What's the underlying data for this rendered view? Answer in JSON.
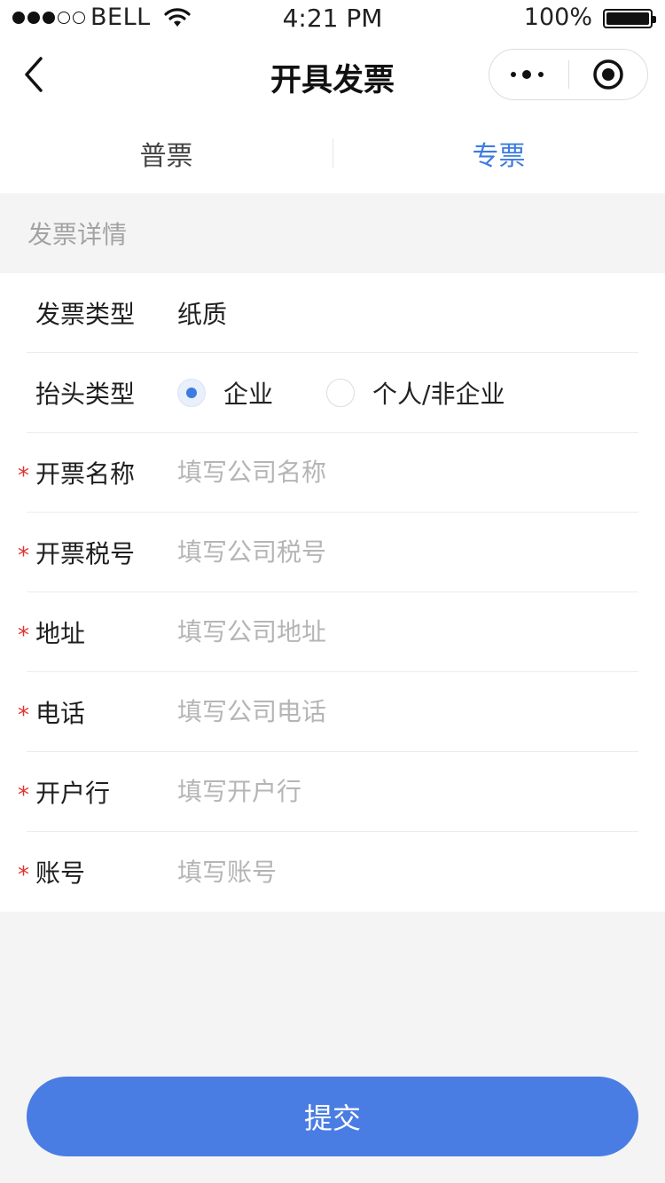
{
  "status_bar": {
    "carrier": "BELL",
    "time": "4:21 PM",
    "battery": "100%"
  },
  "nav": {
    "title": "开具发票"
  },
  "tabs": [
    {
      "label": "普票",
      "active": false
    },
    {
      "label": "专票",
      "active": true
    }
  ],
  "section": {
    "title": "发票详情"
  },
  "form": {
    "invoice_type": {
      "label": "发票类型",
      "value": "纸质"
    },
    "title_type": {
      "label": "抬头类型",
      "options": [
        {
          "label": "企业",
          "checked": true
        },
        {
          "label": "个人/非企业",
          "checked": false
        }
      ]
    },
    "fields": [
      {
        "label": "开票名称",
        "placeholder": "填写公司名称",
        "required": true
      },
      {
        "label": "开票税号",
        "placeholder": "填写公司税号",
        "required": true
      },
      {
        "label": "地址",
        "placeholder": "填写公司地址",
        "required": true
      },
      {
        "label": "电话",
        "placeholder": "填写公司电话",
        "required": true
      },
      {
        "label": "开户行",
        "placeholder": "填写开户行",
        "required": true
      },
      {
        "label": "账号",
        "placeholder": "填写账号",
        "required": true
      }
    ],
    "required_mark": "*"
  },
  "submit": {
    "label": "提交"
  },
  "colors": {
    "accent": "#4a7de3",
    "active_tab": "#3d7be0",
    "required": "#e23232"
  }
}
